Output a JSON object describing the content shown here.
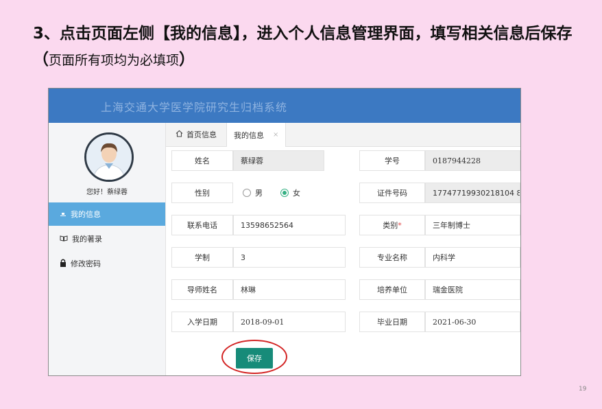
{
  "slide": {
    "title_main": "3、点击页面左侧【我的信息】，进入个人信息管理界面，填写相关信息后保存（",
    "title_note": "页面所有项均为必填项",
    "title_end": "）",
    "page_number": "19"
  },
  "app": {
    "title": "上海交通大学医学院研究生归档系统",
    "colors": {
      "banner": "#3c79c2",
      "active_menu": "#5aa9de",
      "save_button": "#178b79",
      "highlight": "#d32424"
    }
  },
  "sidebar": {
    "greeting": "您好！蔡绿蓉",
    "items": [
      {
        "label": "我的信息",
        "icon": "person-icon",
        "active": true
      },
      {
        "label": "我的著录",
        "icon": "book-icon",
        "active": false
      },
      {
        "label": "修改密码",
        "icon": "lock-icon",
        "active": false
      }
    ]
  },
  "tabs": [
    {
      "label": "首页信息",
      "icon": "home-icon"
    },
    {
      "label": "我的信息",
      "close": "×"
    }
  ],
  "form": {
    "name_label": "姓名",
    "name_value": "蔡绿蓉",
    "student_no_label": "学号",
    "student_no_value": "0187944228",
    "gender_label": "性别",
    "gender_options": [
      "男",
      "女"
    ],
    "gender_selected": "女",
    "id_no_label": "证件号码",
    "id_no_value": "17747719930218104 8",
    "phone_label": "联系电话",
    "phone_value": "13598652564",
    "category_label": "类别",
    "category_required": "*",
    "category_value": "三年制博士",
    "duration_label": "学制",
    "duration_value": "3",
    "major_label": "专业名称",
    "major_value": "内科学",
    "advisor_label": "导师姓名",
    "advisor_value": "林琳",
    "unit_label": "培养单位",
    "unit_value": "瑞金医院",
    "entry_date_label": "入学日期",
    "entry_date_value": "2018-09-01",
    "grad_date_label": "毕业日期",
    "grad_date_value": "2021-06-30"
  },
  "buttons": {
    "save": "保存"
  }
}
